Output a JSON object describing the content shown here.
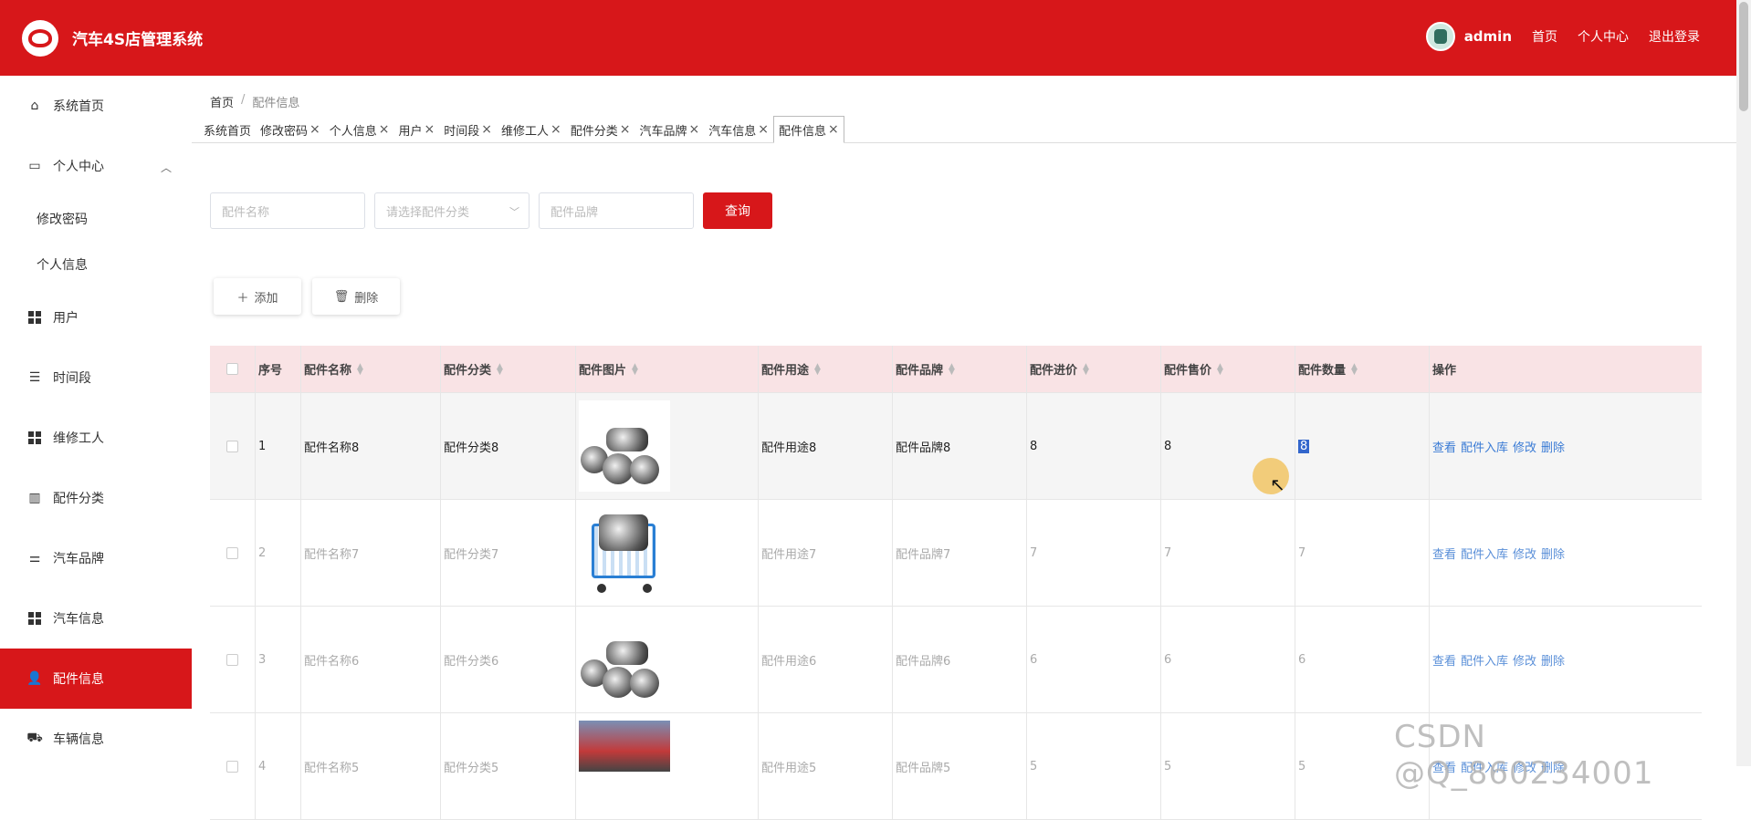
{
  "header": {
    "title": "汽车4S店管理系统",
    "user": "admin",
    "links": [
      "首页",
      "个人中心",
      "退出登录"
    ],
    "color": "#d7171a"
  },
  "sidebar": {
    "items": [
      {
        "label": "系统首页",
        "icon": "home-icon"
      },
      {
        "label": "个人中心",
        "icon": "card-icon"
      },
      {
        "label": "修改密码"
      },
      {
        "label": "个人信息"
      },
      {
        "label": "用户",
        "icon": "grid-icon"
      },
      {
        "label": "时间段",
        "icon": "list-icon"
      },
      {
        "label": "维修工人",
        "icon": "grid-icon"
      },
      {
        "label": "配件分类",
        "icon": "chart-icon"
      },
      {
        "label": "汽车品牌",
        "icon": "sliders-icon"
      },
      {
        "label": "汽车信息",
        "icon": "grid-icon"
      },
      {
        "label": "配件信息",
        "icon": "user-icon"
      },
      {
        "label": "车辆信息",
        "icon": "vehicle-icon"
      }
    ]
  },
  "breadcrumb": {
    "home": "首页",
    "current": "配件信息"
  },
  "tabs": [
    "系统首页",
    "修改密码",
    "个人信息",
    "用户",
    "时间段",
    "维修工人",
    "配件分类",
    "汽车品牌",
    "汽车信息",
    "配件信息"
  ],
  "search": {
    "name_placeholder": "配件名称",
    "category_placeholder": "请选择配件分类",
    "brand_placeholder": "配件品牌",
    "query_label": "查询"
  },
  "actions": {
    "add_label": "添加",
    "delete_label": "删除"
  },
  "table": {
    "headers": [
      "序号",
      "配件名称",
      "配件分类",
      "配件图片",
      "配件用途",
      "配件品牌",
      "配件进价",
      "配件售价",
      "配件数量",
      "操作"
    ],
    "op_labels": [
      "查看",
      "配件入库",
      "修改",
      "删除"
    ],
    "rows": [
      {
        "idx": "1",
        "name": "配件名称8",
        "category": "配件分类8",
        "image": "exhaust-pipes",
        "usage": "配件用途8",
        "brand": "配件品牌8",
        "cost": "8",
        "price": "8",
        "qty": "8"
      },
      {
        "idx": "2",
        "name": "配件名称7",
        "category": "配件分类7",
        "image": "engine-cart",
        "usage": "配件用途7",
        "brand": "配件品牌7",
        "cost": "7",
        "price": "7",
        "qty": "7"
      },
      {
        "idx": "3",
        "name": "配件名称6",
        "category": "配件分类6",
        "image": "exhaust-pipes",
        "usage": "配件用途6",
        "brand": "配件品牌6",
        "cost": "6",
        "price": "6",
        "qty": "6"
      },
      {
        "idx": "4",
        "name": "配件名称5",
        "category": "配件分类5",
        "image": "car-parts",
        "usage": "配件用途5",
        "brand": "配件品牌5",
        "cost": "5",
        "price": "5",
        "qty": "5"
      }
    ]
  },
  "watermark": "CSDN @Q_860234001"
}
